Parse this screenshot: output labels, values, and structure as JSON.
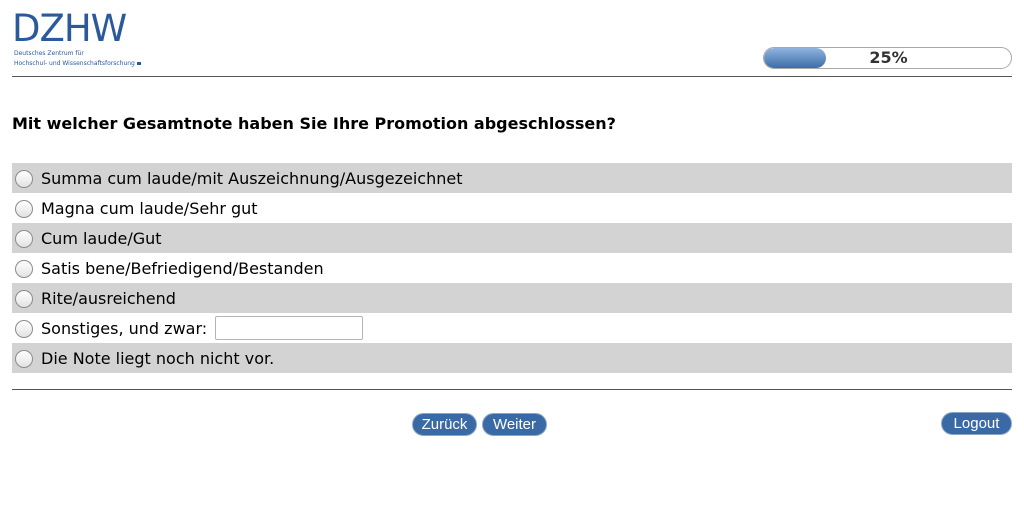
{
  "header": {
    "logo_text": "DZHW",
    "logo_subtitle_line1": "Deutsches Zentrum für",
    "logo_subtitle_line2": "Hochschul- und Wissenschaftsforschung",
    "brand_color": "#2a5a9c"
  },
  "progress": {
    "percent": 25,
    "label": "25%"
  },
  "question": {
    "text": "Mit welcher Gesamtnote haben Sie Ihre Promotion abgeschlossen?"
  },
  "options": [
    {
      "label": "Summa cum laude/mit Auszeichnung/Ausgezeichnet",
      "selected": false
    },
    {
      "label": "Magna cum laude/Sehr gut",
      "selected": false
    },
    {
      "label": "Cum laude/Gut",
      "selected": false
    },
    {
      "label": "Satis bene/Befriedigend/Bestanden",
      "selected": false
    },
    {
      "label": "Rite/ausreichend",
      "selected": false
    },
    {
      "label": "Sonstiges, und zwar:",
      "selected": false,
      "input_value": ""
    },
    {
      "label": "Die Note liegt noch nicht vor.",
      "selected": false
    }
  ],
  "nav": {
    "back_label": "Zurück",
    "next_label": "Weiter",
    "logout_label": "Logout",
    "button_color": "#3a6aa6"
  }
}
